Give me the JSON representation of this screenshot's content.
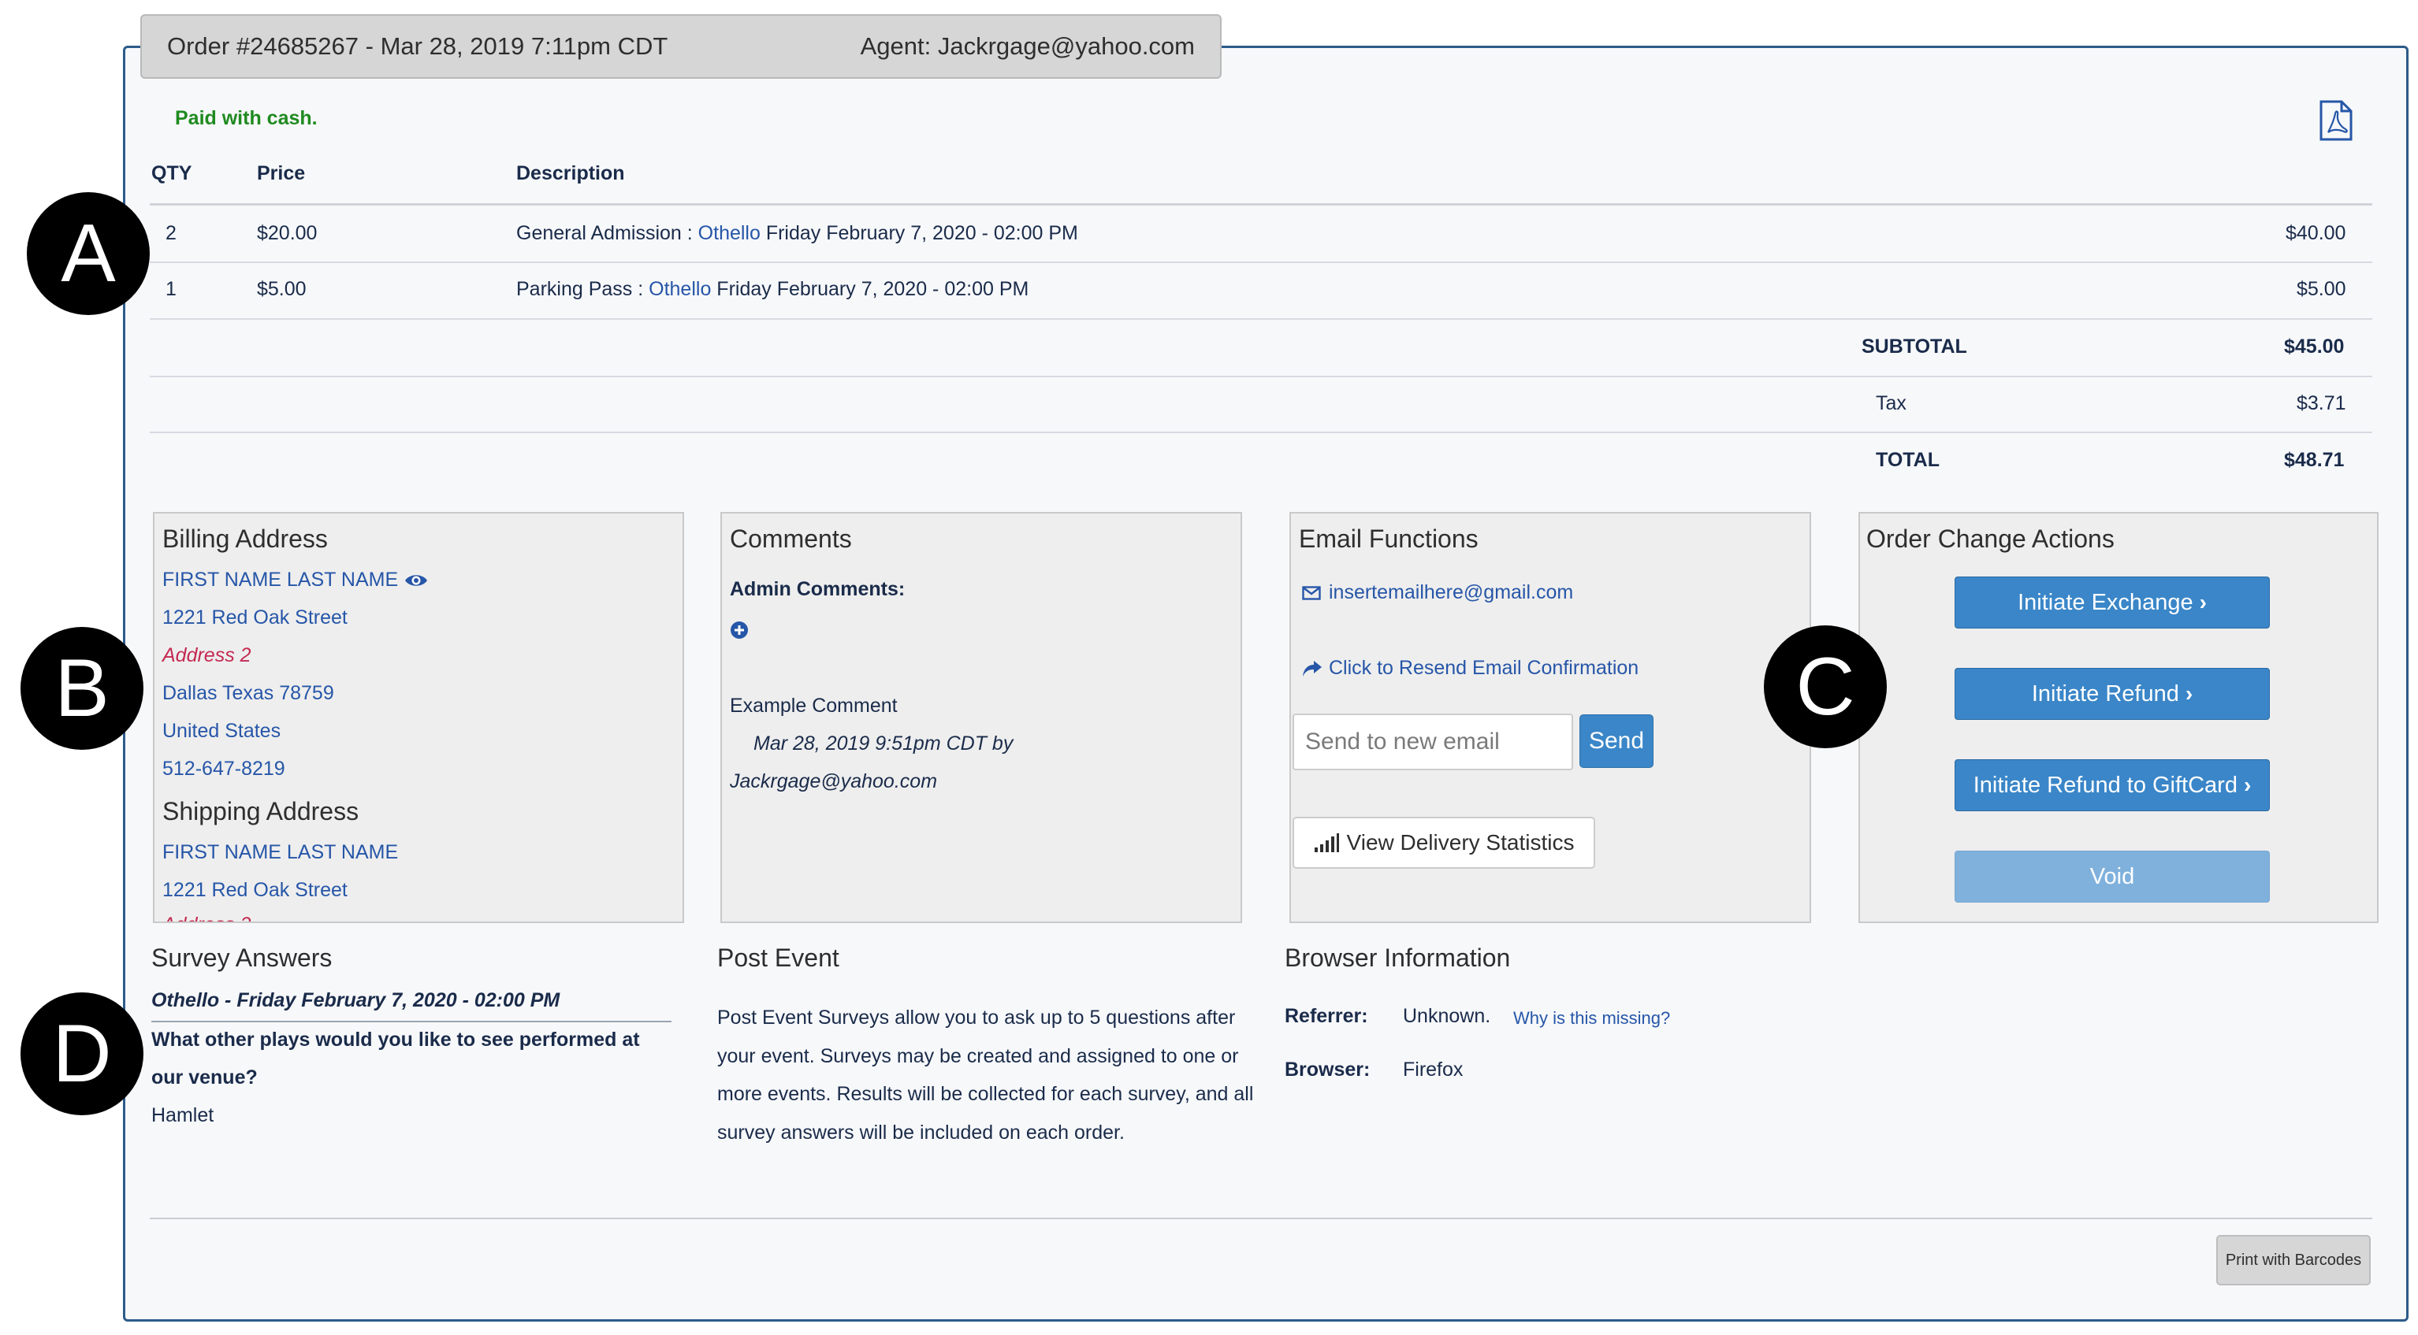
{
  "header": {
    "order_title": "Order #24685267 - Mar 28, 2019 7:11pm CDT",
    "agent": "Agent: Jackrgage@yahoo.com"
  },
  "payment_note": "Paid with cash.",
  "icons": {
    "pdf": "pdf-file-icon",
    "eye": "eye-icon",
    "plus": "plus-circle-icon",
    "envelope": "envelope-icon",
    "resend": "share-arrow-icon",
    "signal": "signal-bars-icon",
    "chevron": "chevron-right-icon"
  },
  "table": {
    "headers": {
      "qty": "QTY",
      "price": "Price",
      "description": "Description"
    },
    "rows": [
      {
        "qty": "2",
        "price": "$20.00",
        "prefix": "General Admission : ",
        "event": "Othello",
        "date": " Friday February 7, 2020 - 02:00 PM",
        "total": "$40.00"
      },
      {
        "qty": "1",
        "price": "$5.00",
        "prefix": "Parking Pass : ",
        "event": "Othello",
        "date": " Friday February 7, 2020 - 02:00 PM",
        "total": "$5.00"
      }
    ],
    "subtotal_label": "SUBTOTAL",
    "subtotal": "$45.00",
    "tax_label": "Tax",
    "tax": "$3.71",
    "total_label": "TOTAL",
    "total": "$48.71"
  },
  "billing": {
    "title": "Billing Address",
    "name": "FIRST NAME LAST NAME",
    "street": "1221 Red Oak Street",
    "address2": "Address 2",
    "city": "Dallas Texas 78759",
    "country": "United States",
    "phone": "512-647-8219",
    "shipping_title": "Shipping Address",
    "ship_name": "FIRST NAME LAST NAME",
    "ship_street": "1221 Red Oak Street"
  },
  "comments": {
    "title": "Comments",
    "admin_label": "Admin Comments:",
    "comment_text": "Example Comment",
    "comment_meta": "Mar 28, 2019 9:51pm CDT by",
    "comment_author": "Jackrgage@yahoo.com"
  },
  "email": {
    "title": "Email Functions",
    "address": "insertemailhere@gmail.com",
    "resend": "Click to Resend Email Confirmation",
    "placeholder": "Send to new email",
    "send": "Send",
    "stats": "View Delivery Statistics"
  },
  "actions": {
    "title": "Order Change Actions",
    "exchange": "Initiate Exchange",
    "refund": "Initiate Refund",
    "refund_giftcard": "Initiate Refund to GiftCard",
    "void": "Void"
  },
  "survey": {
    "title": "Survey Answers",
    "event": "Othello - Friday February 7, 2020 - 02:00 PM",
    "question_line1": "What other plays would you like to see performed at",
    "question_line2": "our venue?",
    "answer": "Hamlet"
  },
  "post_event": {
    "title": "Post Event",
    "text": "Post Event Surveys allow you to ask up to 5 questions after your event. Surveys may be created and assigned to one or more events. Results will be collected for each survey, and all survey answers will be included on each order."
  },
  "browser": {
    "title": "Browser Information",
    "referrer_label": "Referrer:",
    "referrer": "Unknown.",
    "why_link": "Why is this missing?",
    "browser_label": "Browser:",
    "browser": "Firefox"
  },
  "print_button": "Print with Barcodes",
  "markers": {
    "a": "A",
    "b": "B",
    "c": "C",
    "d": "D"
  },
  "colors": {
    "link_blue": "#2656a8",
    "button_blue": "#3a86c8",
    "paid_green": "#1f8a1f",
    "address_red": "#c42a52"
  }
}
